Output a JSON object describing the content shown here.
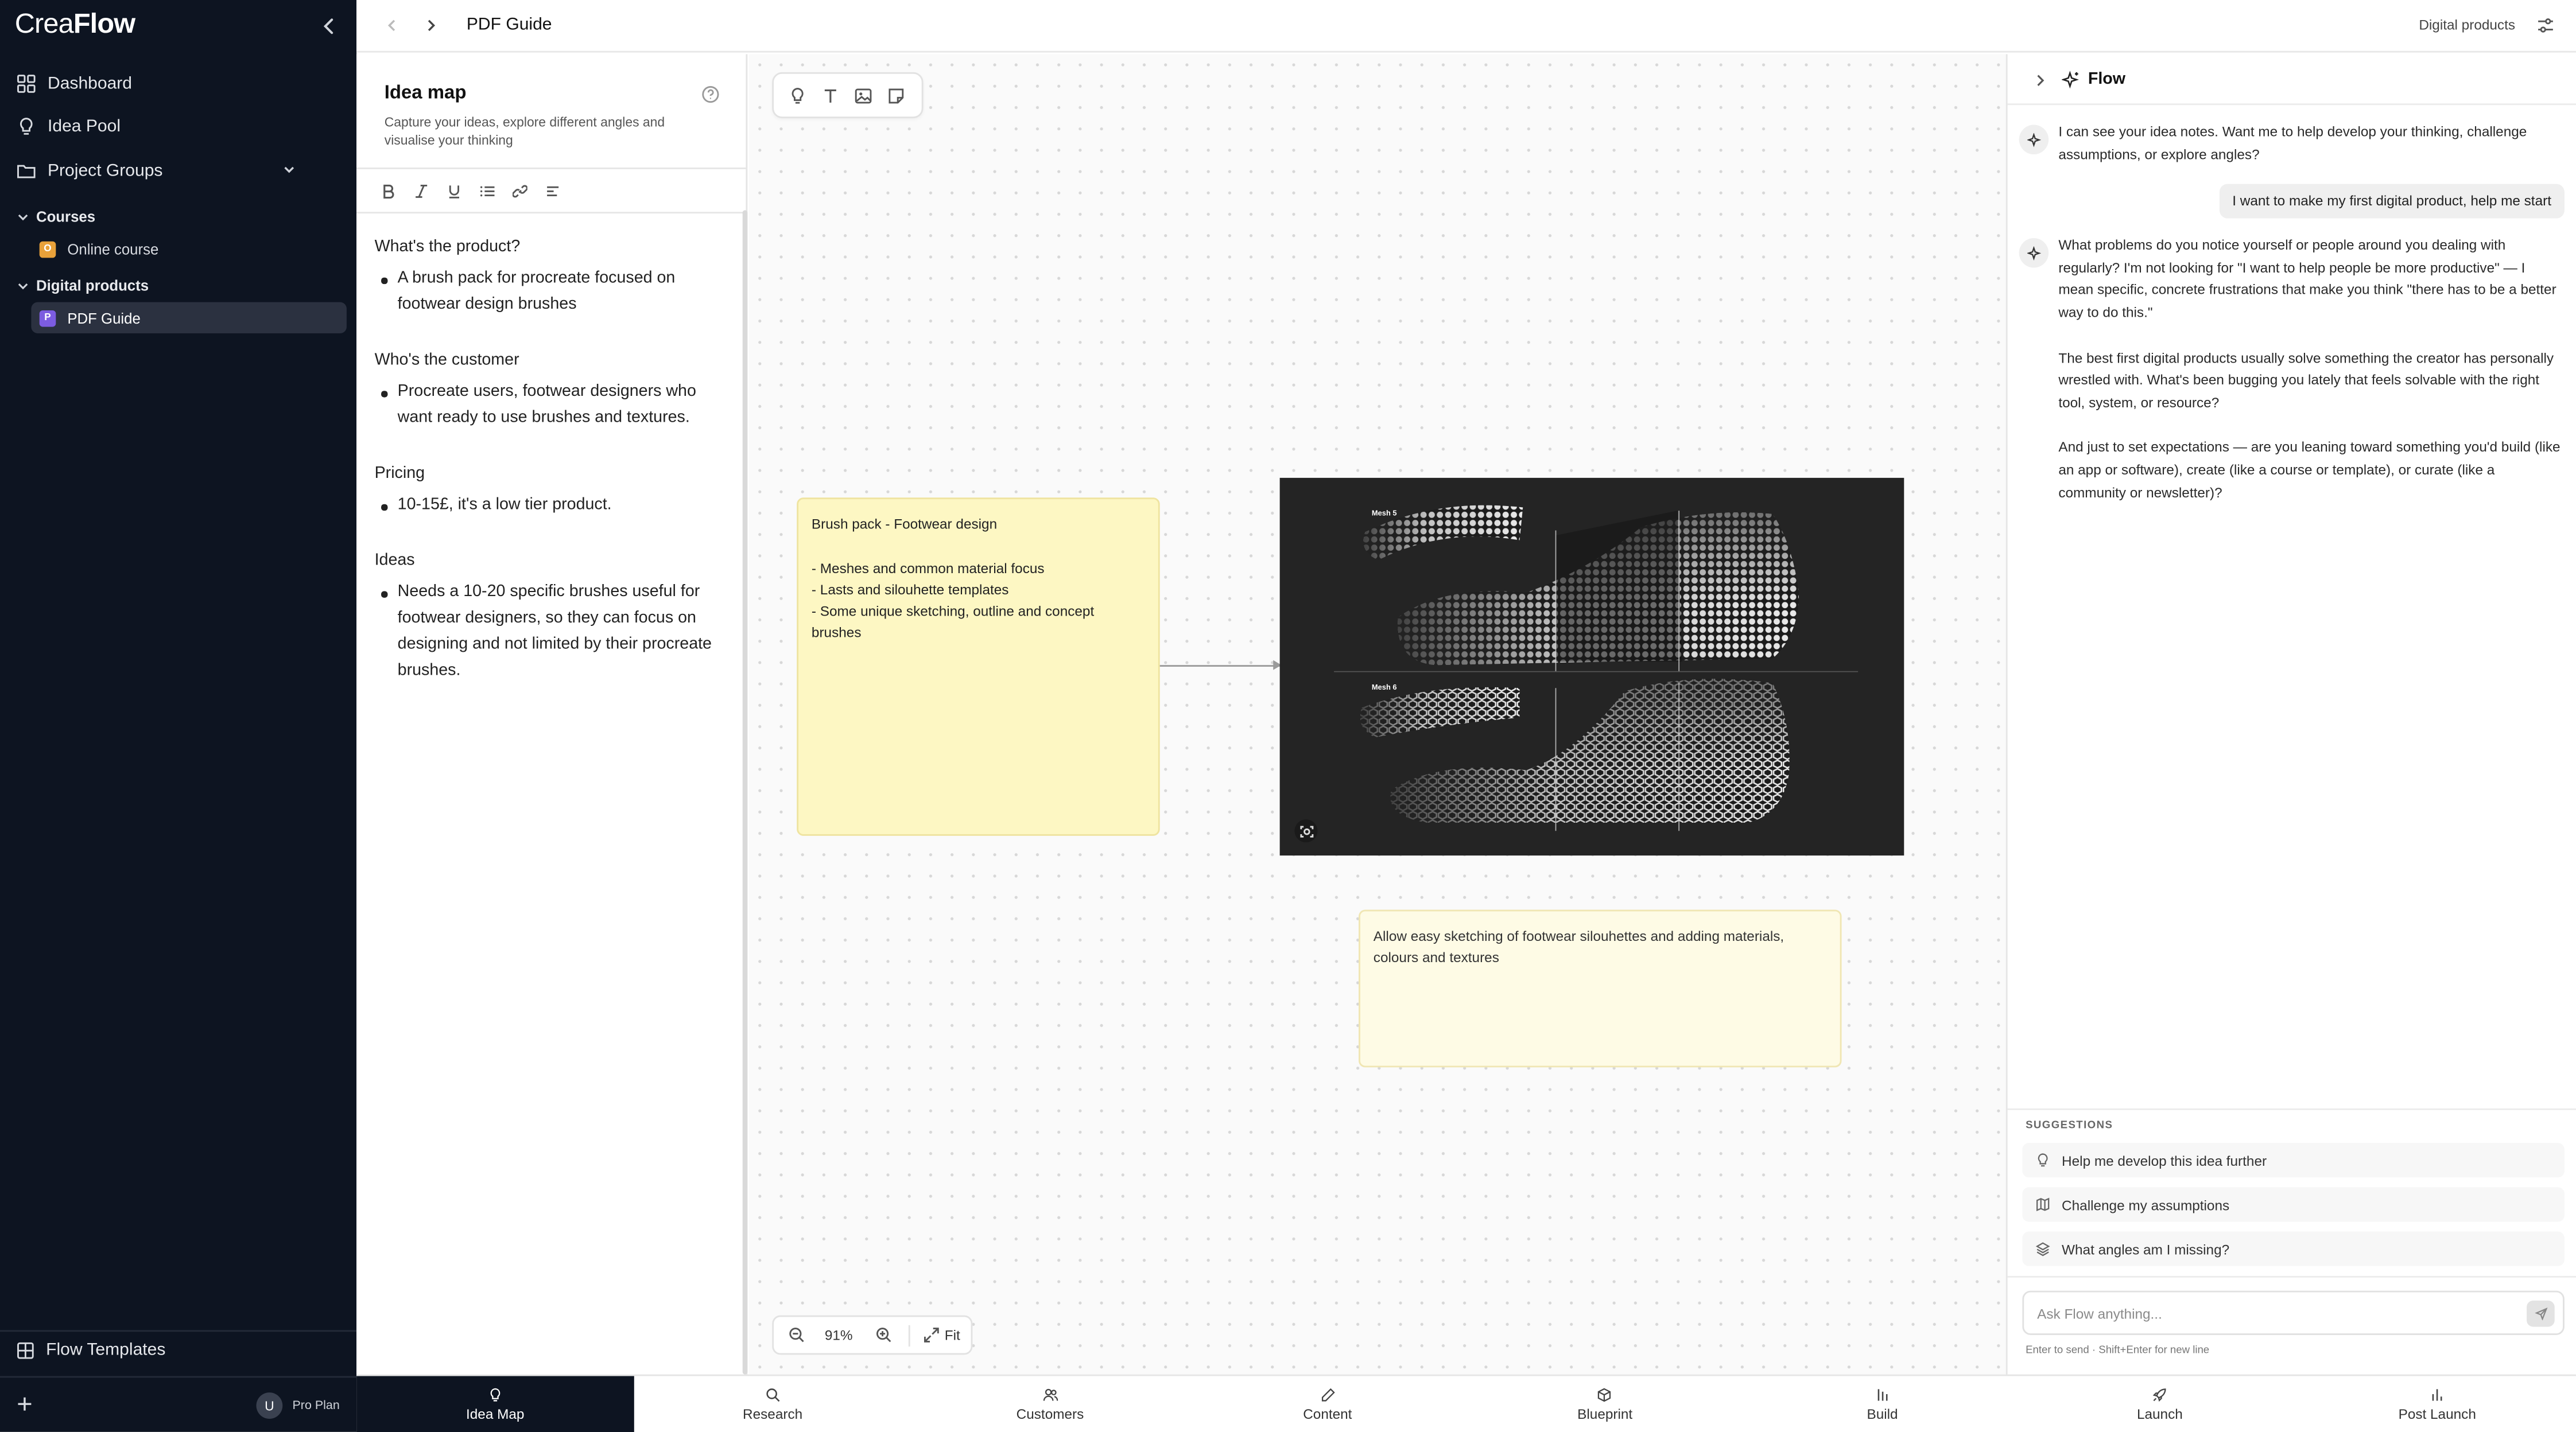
{
  "app": {
    "logo_left": "Crea",
    "logo_right": "Flow"
  },
  "sidebar": {
    "nav": [
      {
        "label": "Dashboard",
        "icon": "grid-icon"
      },
      {
        "label": "Idea Pool",
        "icon": "lightbulb-icon"
      },
      {
        "label": "Project Groups",
        "icon": "folder-icon"
      }
    ],
    "groups": [
      {
        "label": "Courses",
        "items": [
          {
            "label": "Online course",
            "badge": "O",
            "color": "#e8a13a"
          }
        ]
      },
      {
        "label": "Digital products",
        "items": [
          {
            "label": "PDF Guide",
            "badge": "P",
            "color": "#7c5ce0"
          }
        ]
      }
    ],
    "flow_templates": "Flow Templates",
    "user_initial": "U",
    "plan": "Pro Plan"
  },
  "topbar": {
    "title": "PDF Guide",
    "project": "Digital products"
  },
  "idea_panel": {
    "title": "Idea map",
    "subtitle": "Capture your ideas, explore different angles and visualise your thinking",
    "notes": [
      {
        "heading": "What's the product?",
        "bullets": [
          "A brush pack for procreate focused on footwear design brushes"
        ]
      },
      {
        "heading": "Who's the customer",
        "bullets": [
          "Procreate users, footwear designers who want ready to use brushes and textures."
        ]
      },
      {
        "heading": "Pricing",
        "bullets": [
          "10-15£, it's a low tier product."
        ]
      },
      {
        "heading": "Ideas",
        "bullets": [
          "Needs a 10-20 specific brushes useful for footwear designers, so they can focus on designing and not limited by their procreate brushes."
        ]
      }
    ]
  },
  "canvas": {
    "sticky1": {
      "title": "Brush pack - Footwear design",
      "lines": [
        "- Meshes and common material focus",
        "- Lasts and silouhette templates",
        "- Some unique sketching, outline and concept brushes"
      ]
    },
    "sticky2": {
      "text": "Allow easy sketching of footwear silouhettes and adding materials, colours and textures"
    },
    "image_labels": {
      "top": "Mesh 5",
      "bottom": "Mesh 6"
    },
    "zoom": "91%",
    "fit_label": "Fit"
  },
  "flow": {
    "title": "Flow",
    "bot_msg1": "I can see your idea notes. Want me to help develop your thinking, challenge assumptions, or explore angles?",
    "user_msg": "I want to make my first digital product, help me start",
    "bot_msg2": [
      "What problems do you notice yourself or people around you dealing with regularly? I'm not looking for \"I want to help people be more productive\" — I mean specific, concrete frustrations that make you think \"there has to be a better way to do this.\"",
      "The best first digital products usually solve something the creator has personally wrestled with. What's been bugging you lately that feels solvable with the right tool, system, or resource?",
      "And just to set expectations — are you leaning toward something you'd build (like an app or software), create (like a course or template), or curate (like a community or newsletter)?"
    ],
    "suggestions_label": "SUGGESTIONS",
    "suggestions": [
      {
        "label": "Help me develop this idea further",
        "icon": "lightbulb-icon"
      },
      {
        "label": "Challenge my assumptions",
        "icon": "map-icon"
      },
      {
        "label": "What angles am I missing?",
        "icon": "layers-icon"
      }
    ],
    "input_placeholder": "Ask Flow anything...",
    "input_hint": "Enter to send · Shift+Enter for new line"
  },
  "tabs": [
    {
      "label": "Idea Map",
      "icon": "lightbulb-icon",
      "active": true
    },
    {
      "label": "Research",
      "icon": "search-icon"
    },
    {
      "label": "Customers",
      "icon": "users-icon"
    },
    {
      "label": "Content",
      "icon": "pencil-icon"
    },
    {
      "label": "Blueprint",
      "icon": "cube-icon"
    },
    {
      "label": "Build",
      "icon": "bars-icon"
    },
    {
      "label": "Launch",
      "icon": "rocket-icon"
    },
    {
      "label": "Post Launch",
      "icon": "chart-icon"
    }
  ]
}
